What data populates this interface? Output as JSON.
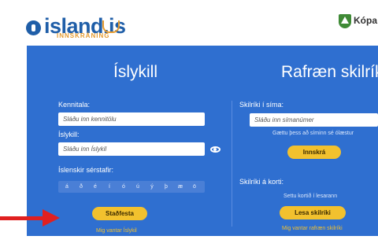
{
  "header": {
    "logo_text": "island.is",
    "logo_subtitle": "INNSKRÁNING",
    "municipality": "Kópa"
  },
  "left": {
    "title": "Íslykill",
    "kennitala_label": "Kennitala:",
    "kennitala_placeholder": "Sláðu inn kennitölu",
    "islykill_label": "Íslykill:",
    "islykill_placeholder": "Sláðu inn Íslykil",
    "chars_label": "Íslenskir sérstafir:",
    "chars": [
      "á",
      "ð",
      "é",
      "í",
      "ó",
      "ú",
      "ý",
      "þ",
      "æ",
      "ö"
    ],
    "submit": "Staðfesta",
    "missing_link": "Mig vantar Íslykil"
  },
  "right": {
    "title": "Rafræn skilríki",
    "phone_label": "Skilríki í síma:",
    "phone_placeholder": "Sláðu inn símanúmer",
    "phone_hint": "Gættu þess að síminn sé ólæstur",
    "phone_button": "Innskrá",
    "card_label": "Skilríki á korti:",
    "card_hint": "Settu kortið í lesarann",
    "card_button": "Lesa skilríki",
    "missing_link": "Mig vantar rafræn skilríki"
  },
  "colors": {
    "panel": "#2f6fd0",
    "button": "#f2c12e",
    "arrow": "#e02020"
  }
}
